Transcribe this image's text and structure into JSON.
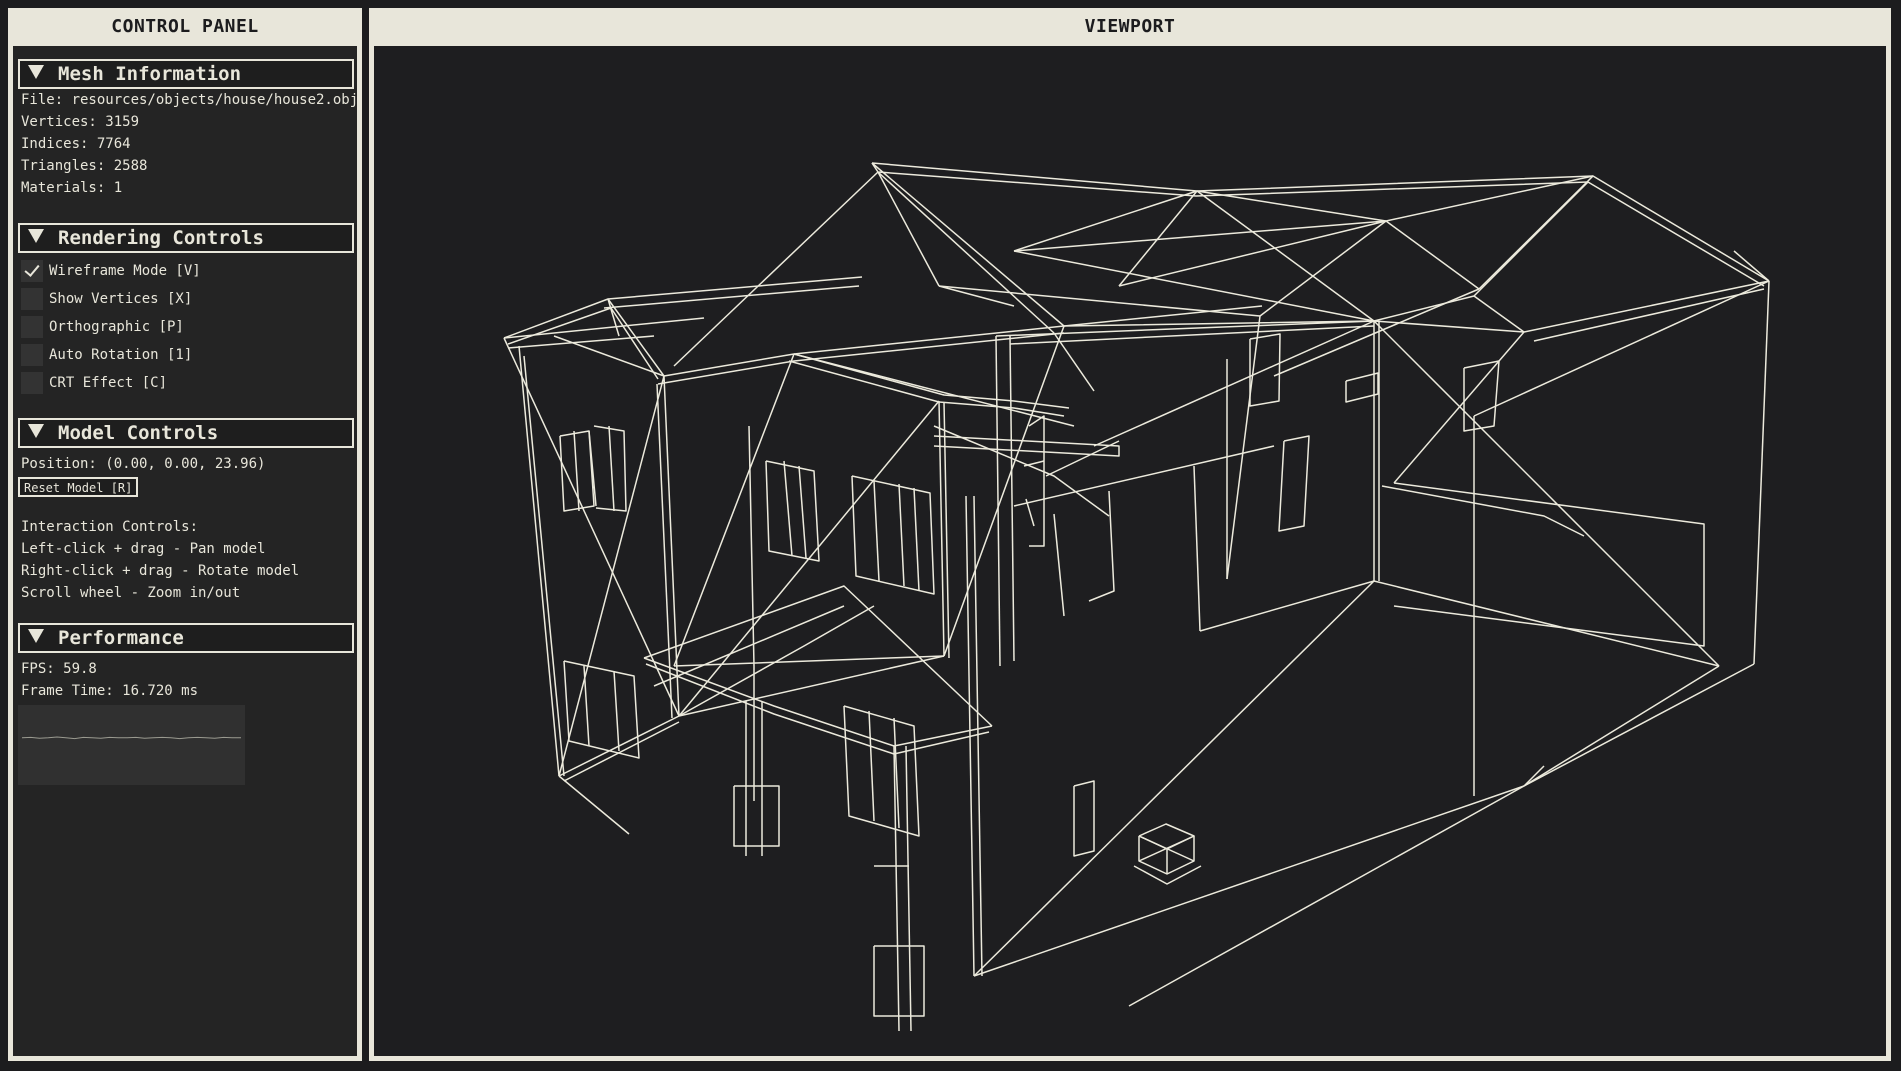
{
  "control_panel": {
    "title": "CONTROL PANEL",
    "mesh_info": {
      "header": "Mesh Information",
      "file": "File: resources/objects/house/house2.obj",
      "vertices": "Vertices: 3159",
      "indices": "Indices: 7764",
      "triangles": "Triangles: 2588",
      "materials": "Materials: 1"
    },
    "rendering": {
      "header": "Rendering Controls",
      "options": [
        {
          "label": "Wireframe Mode [V]",
          "checked": true
        },
        {
          "label": "Show Vertices [X]",
          "checked": false
        },
        {
          "label": "Orthographic [P]",
          "checked": false
        },
        {
          "label": "Auto Rotation [1]",
          "checked": false
        },
        {
          "label": "CRT Effect [C]",
          "checked": false
        }
      ]
    },
    "model": {
      "header": "Model Controls",
      "position": "Position: (0.00, 0.00, 23.96)",
      "reset_label": "Reset Model [R]",
      "interaction_title": "Interaction Controls:",
      "interaction_lines": [
        "Left-click + drag - Pan model",
        "Right-click + drag - Rotate model",
        "Scroll wheel - Zoom in/out"
      ]
    },
    "performance": {
      "header": "Performance",
      "fps": "FPS: 59.8",
      "frame_time": "Frame Time: 16.720 ms",
      "fps_samples": [
        59.8,
        59.9,
        59.7,
        59.8,
        60.0,
        59.8,
        59.6,
        59.9,
        59.8,
        59.7,
        59.9,
        59.8,
        59.8,
        59.9,
        59.7,
        59.8,
        59.9,
        59.8,
        59.6,
        59.8,
        59.9,
        59.8,
        59.7,
        59.9,
        59.8,
        59.8
      ]
    }
  },
  "viewport": {
    "title": "VIEWPORT",
    "model_name": "house2.obj",
    "render_mode": "wireframe"
  },
  "colors": {
    "frame": "#e8e6da",
    "background": "#1e1e20",
    "wire": "#eceadc"
  },
  "icons": {
    "section_toggle": "triangle-down-icon",
    "checkbox_mark": "checkmark-icon"
  }
}
